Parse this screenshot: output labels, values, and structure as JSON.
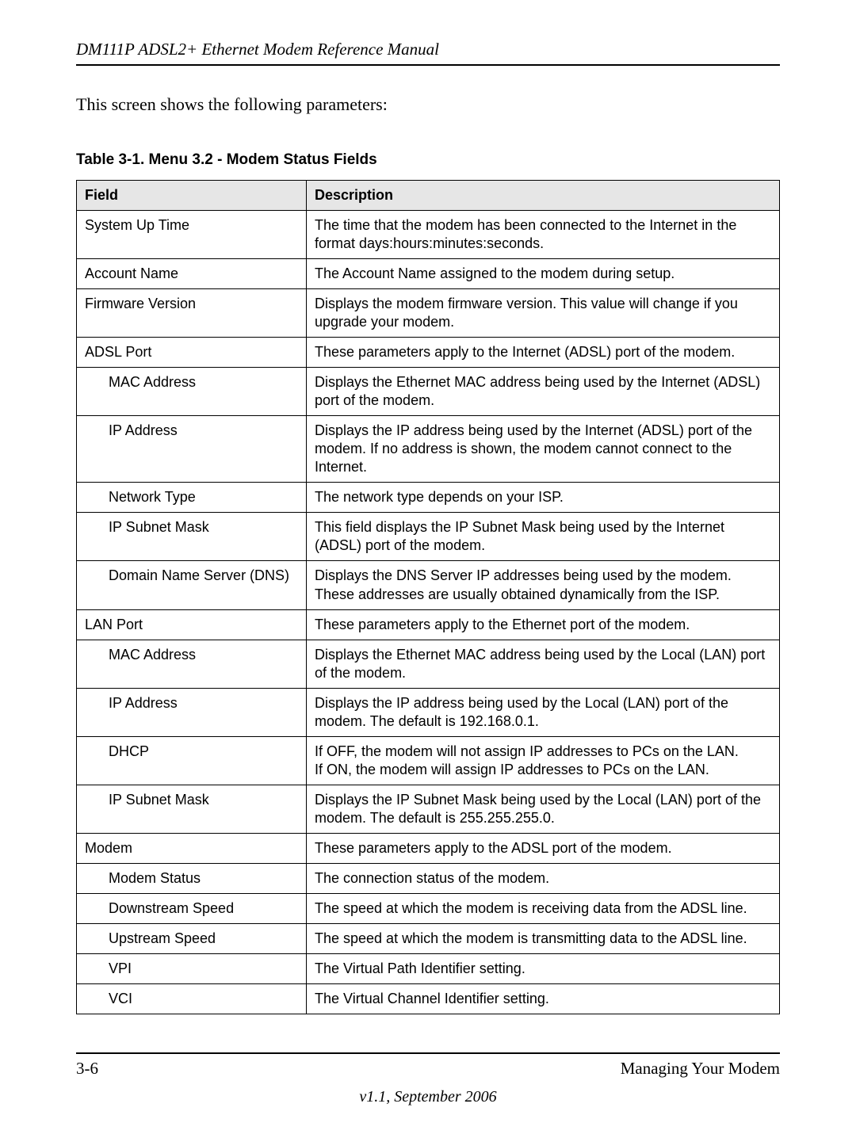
{
  "header": {
    "running_head": "DM111P ADSL2+ Ethernet Modem Reference Manual"
  },
  "intro": "This screen shows the following parameters:",
  "table_caption": "Table 3-1. Menu 3.2 - Modem Status Fields",
  "columns": {
    "field": "Field",
    "description": "Description"
  },
  "rows": [
    {
      "indent": 0,
      "field": "System Up Time",
      "desc": "The time that the modem has been connected to the Internet in the format days:hours:minutes:seconds."
    },
    {
      "indent": 0,
      "field": "Account Name",
      "desc": "The Account Name assigned to the modem during setup."
    },
    {
      "indent": 0,
      "field": "Firmware Version",
      "desc": "Displays the modem firmware version. This value will change if you upgrade your modem."
    },
    {
      "indent": 0,
      "field": "ADSL Port",
      "desc": "These parameters apply to the Internet (ADSL) port of the modem."
    },
    {
      "indent": 1,
      "field": "MAC Address",
      "desc": "Displays the Ethernet MAC address being used by the Internet (ADSL) port of the modem."
    },
    {
      "indent": 1,
      "field": "IP Address",
      "desc": "Displays the IP address being used by the Internet (ADSL) port of the modem. If no address is shown, the modem cannot connect to the Internet."
    },
    {
      "indent": 1,
      "field": "Network Type",
      "desc": "The network type depends on your ISP."
    },
    {
      "indent": 1,
      "field": "IP Subnet Mask",
      "desc": "This field displays the IP Subnet Mask being used by the Internet (ADSL) port of the modem."
    },
    {
      "indent": 1,
      "field": "Domain Name Server (DNS)",
      "desc": "Displays the DNS Server IP addresses being used by the modem. These addresses are usually obtained dynamically from the ISP."
    },
    {
      "indent": 0,
      "field": "LAN Port",
      "desc": "These parameters apply to the Ethernet port of the modem."
    },
    {
      "indent": 1,
      "field": "MAC Address",
      "desc": "Displays the Ethernet MAC address being used by the Local (LAN) port of the modem."
    },
    {
      "indent": 1,
      "field": "IP Address",
      "desc": "Displays the IP address being used by the Local (LAN) port of the modem. The default is 192.168.0.1."
    },
    {
      "indent": 1,
      "field": "DHCP",
      "desc": "If OFF, the modem will not assign IP addresses to PCs on the LAN.\nIf ON, the modem will assign IP addresses to PCs on the LAN."
    },
    {
      "indent": 1,
      "field": "IP Subnet Mask",
      "desc": "Displays the IP Subnet Mask being used by the Local (LAN) port of the modem. The default is 255.255.255.0."
    },
    {
      "indent": 0,
      "field": "Modem",
      "desc": "These parameters apply to the ADSL port of the modem."
    },
    {
      "indent": 1,
      "field": "Modem Status",
      "desc": "The connection status of the modem."
    },
    {
      "indent": 1,
      "field": "Downstream Speed",
      "desc": "The speed at which the modem is receiving data from the ADSL line."
    },
    {
      "indent": 1,
      "field": "Upstream Speed",
      "desc": "The speed at which the modem is transmitting data to the ADSL line."
    },
    {
      "indent": 1,
      "field": "VPI",
      "desc": "The Virtual Path Identifier setting."
    },
    {
      "indent": 1,
      "field": "VCI",
      "desc": "The Virtual Channel Identifier setting."
    }
  ],
  "footer": {
    "page_num": "3-6",
    "section": "Managing Your Modem",
    "version": "v1.1, September 2006"
  }
}
